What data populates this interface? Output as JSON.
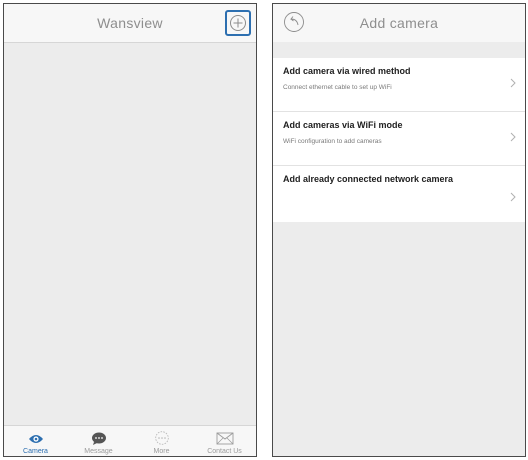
{
  "left": {
    "title": "Wansview",
    "tabs": [
      {
        "label": "Camera",
        "icon": "eye-icon"
      },
      {
        "label": "Message",
        "icon": "chat-bubble-icon"
      },
      {
        "label": "More",
        "icon": "dots-circle-icon"
      },
      {
        "label": "Contact Us",
        "icon": "envelope-icon"
      }
    ]
  },
  "right": {
    "title": "Add camera",
    "items": [
      {
        "title": "Add camera via wired method",
        "subtitle": "Connect ethernet cable to set up WiFi"
      },
      {
        "title": "Add cameras via WiFi mode",
        "subtitle": "WiFi configuration to add cameras"
      },
      {
        "title": "Add already connected network camera",
        "subtitle": ""
      }
    ]
  },
  "colors": {
    "accent": "#2d6fb0",
    "background": "#ececec",
    "navbar": "#f7f7f7"
  }
}
